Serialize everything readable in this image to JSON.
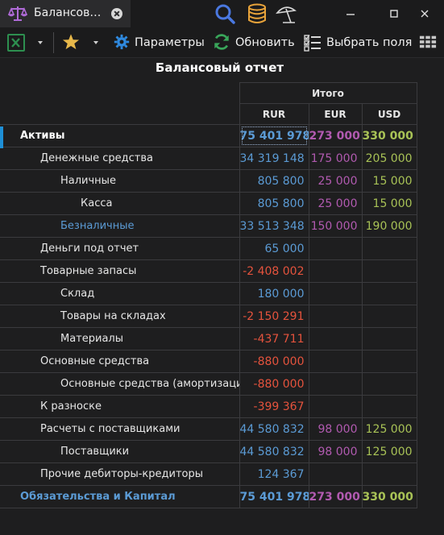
{
  "tab": {
    "title": "Балансов…"
  },
  "toolbar": {
    "parameters_label": "Параметры",
    "refresh_label": "Обновить",
    "select_fields_label": "Выбрать поля"
  },
  "report": {
    "title": "Балансовый отчет",
    "total_header": "Итого",
    "currencies": [
      "RUR",
      "EUR",
      "USD"
    ],
    "rows": [
      {
        "label": "Активы",
        "rur": "75 401 978",
        "eur": "273 000",
        "usd": "330 000"
      },
      {
        "label": "Денежные средства",
        "rur": "34 319 148",
        "eur": "175 000",
        "usd": "205 000"
      },
      {
        "label": "Наличные",
        "rur": "805 800",
        "eur": "25 000",
        "usd": "15 000"
      },
      {
        "label": "Касса",
        "rur": "805 800",
        "eur": "25 000",
        "usd": "15 000"
      },
      {
        "label": "Безналичные",
        "rur": "33 513 348",
        "eur": "150 000",
        "usd": "190 000"
      },
      {
        "label": "Деньги под отчет",
        "rur": "65 000",
        "eur": "",
        "usd": ""
      },
      {
        "label": "Товарные запасы",
        "rur": "-2 408 002",
        "eur": "",
        "usd": ""
      },
      {
        "label": "Склад",
        "rur": "180 000",
        "eur": "",
        "usd": ""
      },
      {
        "label": "Товары на складах",
        "rur": "-2 150 291",
        "eur": "",
        "usd": ""
      },
      {
        "label": "Материалы",
        "rur": "-437 711",
        "eur": "",
        "usd": ""
      },
      {
        "label": "Основные средства",
        "rur": "-880 000",
        "eur": "",
        "usd": ""
      },
      {
        "label": "Основные средства (амортизация)",
        "rur": "-880 000",
        "eur": "",
        "usd": ""
      },
      {
        "label": "К разноске",
        "rur": "-399 367",
        "eur": "",
        "usd": ""
      },
      {
        "label": "Расчеты с поставщиками",
        "rur": "44 580 832",
        "eur": "98 000",
        "usd": "125 000"
      },
      {
        "label": "Поставщики",
        "rur": "44 580 832",
        "eur": "98 000",
        "usd": "125 000"
      },
      {
        "label": "Прочие дебиторы-кредиторы",
        "rur": "124 367",
        "eur": "",
        "usd": ""
      },
      {
        "label": "Обязательства и Капитал",
        "rur": "75 401 978",
        "eur": "273 000",
        "usd": "330 000"
      }
    ]
  },
  "colors": {
    "rur_positive": "#5b9bd5",
    "negative": "#e5533d",
    "eur": "#b15ab0",
    "usd": "#a8c256",
    "selection_marker": "#1e8fd6"
  },
  "icons": {
    "tab": "scales-icon",
    "search": "magnifier-icon",
    "database": "database-icon",
    "beach": "beach-umbrella-icon",
    "excel": "excel-icon",
    "favorites": "star-icon",
    "parameters": "gear-icon",
    "refresh": "refresh-icon",
    "select_fields": "checklist-icon",
    "layout": "grid-icon"
  }
}
